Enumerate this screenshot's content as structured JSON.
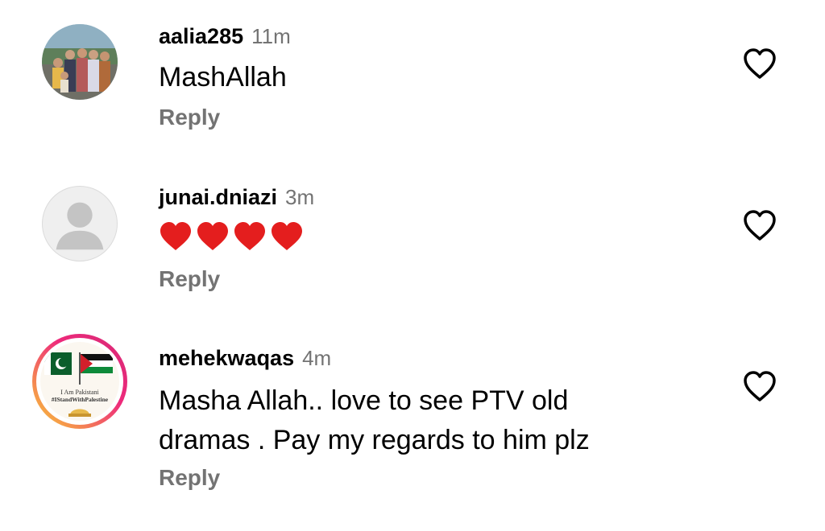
{
  "comments": [
    {
      "username": "aalia285",
      "time": "11m",
      "text": "MashAllah",
      "reply_label": "Reply",
      "avatar_icon": "family-photo-avatar",
      "like_icon": "heart-outline-icon"
    },
    {
      "username": "junai.dniazi",
      "time": "3m",
      "text": "❤️❤️❤️❤️",
      "reply_label": "Reply",
      "avatar_icon": "default-user-avatar",
      "like_icon": "heart-outline-icon"
    },
    {
      "username": "mehekwaqas",
      "time": "4m",
      "text_lines": [
        "Masha Allah.. love to see PTV old",
        "dramas . Pay my regards to him plz"
      ],
      "reply_label": "Reply",
      "avatar_icon": "pakistan-palestine-avatar",
      "avatar_text": [
        "I Am Pakistani",
        "#IStandWithPalestine"
      ],
      "like_icon": "heart-outline-icon"
    }
  ],
  "colors": {
    "secondary_text": "#737373",
    "heart_red": "#e41e1e",
    "story_ring_start": "#f9ce34",
    "story_ring_end": "#d62976"
  }
}
